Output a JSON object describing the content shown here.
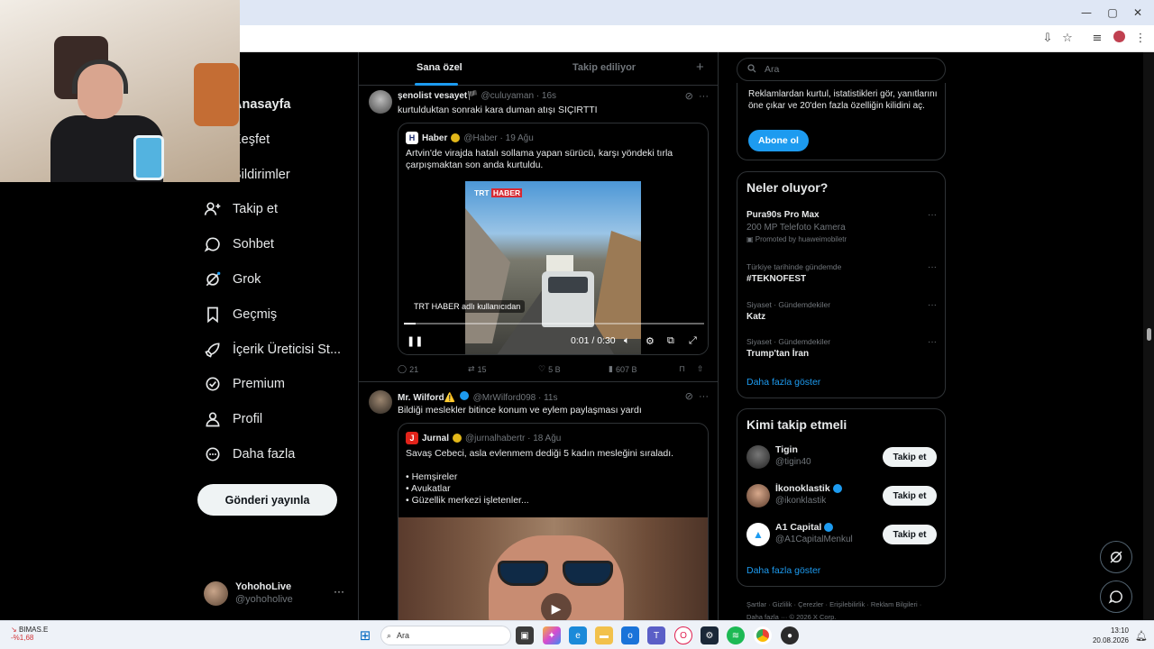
{
  "browser": {
    "window_controls": [
      "—",
      "▢",
      "✕"
    ]
  },
  "nav": {
    "items": [
      {
        "label": "Anasayfa",
        "icon": "home-icon"
      },
      {
        "label": "Keşfet",
        "icon": "search-icon"
      },
      {
        "label": "Bildirimler",
        "icon": "bell-icon"
      },
      {
        "label": "Takip et",
        "icon": "follow-icon"
      },
      {
        "label": "Sohbet",
        "icon": "chat-icon"
      },
      {
        "label": "Grok",
        "icon": "grok-icon"
      },
      {
        "label": "Geçmiş",
        "icon": "bookmark-icon"
      },
      {
        "label": "İçerik Üreticisi St...",
        "icon": "rocket-icon"
      },
      {
        "label": "Premium",
        "icon": "verified-icon"
      },
      {
        "label": "Profil",
        "icon": "person-icon"
      },
      {
        "label": "Daha fazla",
        "icon": "more-icon"
      }
    ],
    "post_button": "Gönderi yayınla",
    "account": {
      "name": "YohohoLive",
      "handle": "@yohoholive",
      "more": "···"
    }
  },
  "timeline": {
    "tabs": [
      {
        "label": "Sana özel",
        "active": true
      },
      {
        "label": "Takip ediliyor",
        "active": false
      }
    ],
    "add_tab": "+",
    "tweets": [
      {
        "name": "şenolist vesayet🏴",
        "handle": "@culuyaman · 16s",
        "text": "kurtulduktan sonraki kara duman atışı SIÇIRTTI",
        "quote": {
          "name": "Haber",
          "handle": "@Haber · 19 Ağu",
          "text": "Artvin'de virajda hatalı sollama yapan sürücü, karşı yöndeki tırla çarpışmaktan son anda kurtuldu.",
          "video": {
            "logo_trt": "TRT",
            "logo_haber": "HABER",
            "label": "TRT HABER adlı kullanıcıdan",
            "time": "0:01 / 0:30",
            "progress": 0.04
          }
        },
        "stats": {
          "replies": "21",
          "retweets": "15",
          "likes": "5 B",
          "views": "607 B"
        }
      },
      {
        "name": "Mr. Wilford⚠️",
        "handle": "@MrWilford098 · 11s",
        "text": "Bildiği meslekler bitince konum ve eylem paylaşması yardı",
        "quote": {
          "name": "Jurnal",
          "handle": "@jurnalhabertr · 18 Ağu",
          "text": "Savaş Cebeci, asla evlenmem dediği 5 kadın mesleğini sıraladı.\n\n• Hemşireler\n• Avukatlar\n• Güzellik merkezi işletenler..."
        }
      }
    ]
  },
  "right": {
    "search_placeholder": "Ara",
    "premium_text": "Reklamlardan kurtul, istatistikleri gör, yanıtlarını öne çıkar ve 20'den fazla özelliğin kilidini aç.",
    "subscribe": "Abone ol",
    "trends_title": "Neler oluyor?",
    "trends": [
      {
        "category": "",
        "name": "Pura90s Pro Max",
        "sub": "200 MP Telefoto Kamera",
        "promo": "Promoted by huaweimobiletr"
      },
      {
        "category": "Türkiye tarihinde gündemde",
        "name": "#TEKNOFEST",
        "sub": "",
        "promo": ""
      },
      {
        "category": "Siyaset · Gündemdekiler",
        "name": "Katz",
        "sub": "",
        "promo": ""
      },
      {
        "category": "Siyaset · Gündemdekiler",
        "name": "Trump'tan İran",
        "sub": "",
        "promo": ""
      }
    ],
    "show_more": "Daha fazla göster",
    "who_title": "Kimi takip etmeli",
    "who": [
      {
        "name": "Tigin",
        "handle": "@tigin40",
        "verified": false,
        "button": "Takip et"
      },
      {
        "name": "İkonoklastik",
        "handle": "@ikonklastik",
        "verified": true,
        "button": "Takip et"
      },
      {
        "name": "A1 Capital",
        "handle": "@A1CapitalMenkul",
        "verified": true,
        "button": "Takip et"
      }
    ],
    "who_more": "Daha fazla göster",
    "footer": "Şartlar · Gizlilik · Çerezler · Erişilebilirlik · Reklam Bilgileri · Daha fazla ··· © 2026 X Corp."
  },
  "taskbar": {
    "stock_name": "BIMAS.E",
    "stock_change": "-%1,68",
    "search": "Ara",
    "time": "13:10",
    "date": "20.08.2026"
  },
  "colors": {
    "accent": "#1d9bf0",
    "background": "#000000",
    "border": "#2f3336",
    "muted": "#71767b"
  }
}
